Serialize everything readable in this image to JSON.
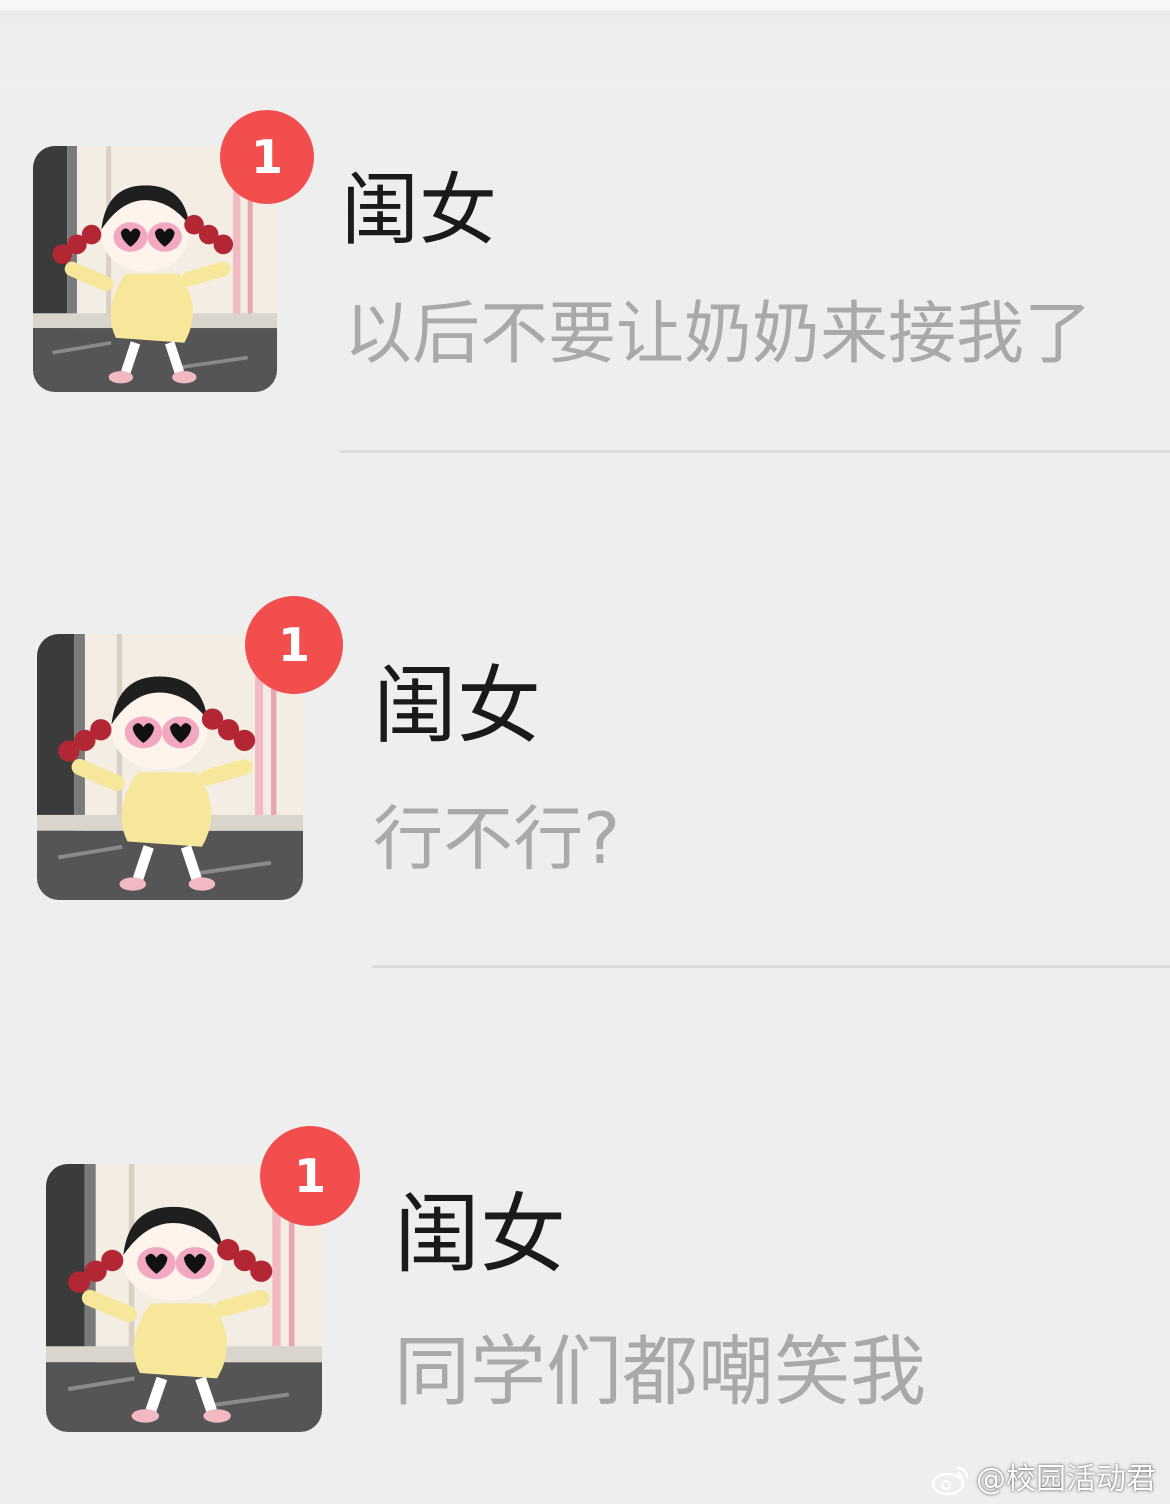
{
  "chats": [
    {
      "name": "闺女",
      "unread": "1",
      "preview": "以后不要让奶奶来接我了",
      "avatar_icon": "cartoon-girl-sunglasses-avatar"
    },
    {
      "name": "闺女",
      "unread": "1",
      "preview": "行不行?",
      "avatar_icon": "cartoon-girl-sunglasses-avatar"
    },
    {
      "name": "闺女",
      "unread": "1",
      "preview": "同学们都嘲笑我",
      "avatar_icon": "cartoon-girl-sunglasses-avatar"
    }
  ],
  "watermark": {
    "text": "@校园活动君",
    "icon": "weibo-logo-icon"
  },
  "colors": {
    "background": "#eeeeee",
    "badge": "#f24e4e",
    "name_text": "#1a1a1a",
    "preview_text": "#a9a9a9",
    "divider": "#dcdcdc"
  }
}
